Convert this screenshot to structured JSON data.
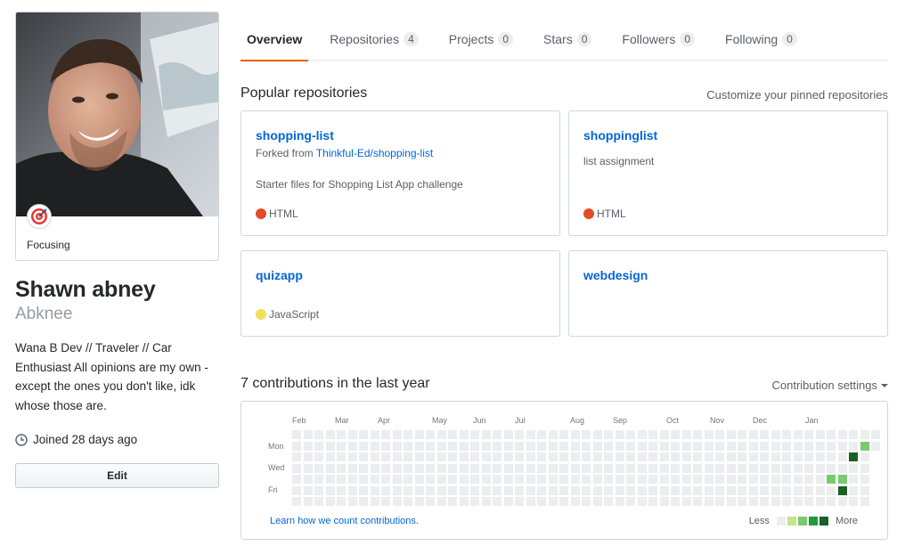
{
  "profile": {
    "status_emoji": "direct-hit-icon",
    "status_text": "Focusing",
    "full_name": "Shawn abney",
    "username": "Abknee",
    "bio": "Wana B Dev // Traveler // Car Enthusiast All opinions are my own - except the ones you don't like, idk whose those are.",
    "joined_text": "Joined 28 days ago",
    "edit_label": "Edit"
  },
  "tabs": [
    {
      "label": "Overview",
      "count": null,
      "active": true
    },
    {
      "label": "Repositories",
      "count": "4",
      "active": false
    },
    {
      "label": "Projects",
      "count": "0",
      "active": false
    },
    {
      "label": "Stars",
      "count": "0",
      "active": false
    },
    {
      "label": "Followers",
      "count": "0",
      "active": false
    },
    {
      "label": "Following",
      "count": "0",
      "active": false
    }
  ],
  "popular": {
    "title": "Popular repositories",
    "customize_label": "Customize your pinned repositories",
    "repos": [
      {
        "name": "shopping-list",
        "forked_prefix": "Forked from ",
        "forked_from": "Thinkful-Ed/shopping-list",
        "description": "Starter files for Shopping List App challenge",
        "language": "HTML",
        "language_color": "#e34c26"
      },
      {
        "name": "shoppinglist",
        "description": "list assignment",
        "language": "HTML",
        "language_color": "#e34c26"
      },
      {
        "name": "quizapp",
        "language": "JavaScript",
        "language_color": "#f1e05a"
      },
      {
        "name": "webdesign"
      }
    ]
  },
  "contributions": {
    "title": "7 contributions in the last year",
    "settings_label": "Contribution settings",
    "months": [
      "Feb",
      "Mar",
      "Apr",
      "May",
      "Jun",
      "Jul",
      "Aug",
      "Sep",
      "Oct",
      "Nov",
      "Dec",
      "Jan"
    ],
    "days": [
      "Mon",
      "Wed",
      "Fri"
    ],
    "learn_label": "Learn how we count contributions.",
    "legend_less": "Less",
    "legend_more": "More",
    "level_colors": [
      "#ebedf0",
      "#c6e48b",
      "#7bc96f",
      "#239a3b",
      "#196127"
    ],
    "weeks": 53,
    "last_week_days": 2,
    "active_cells": [
      {
        "week": 48,
        "day": 4,
        "level": 2
      },
      {
        "week": 49,
        "day": 4,
        "level": 2
      },
      {
        "week": 49,
        "day": 5,
        "level": 4
      },
      {
        "week": 50,
        "day": 2,
        "level": 4
      },
      {
        "week": 51,
        "day": 1,
        "level": 2
      }
    ]
  }
}
